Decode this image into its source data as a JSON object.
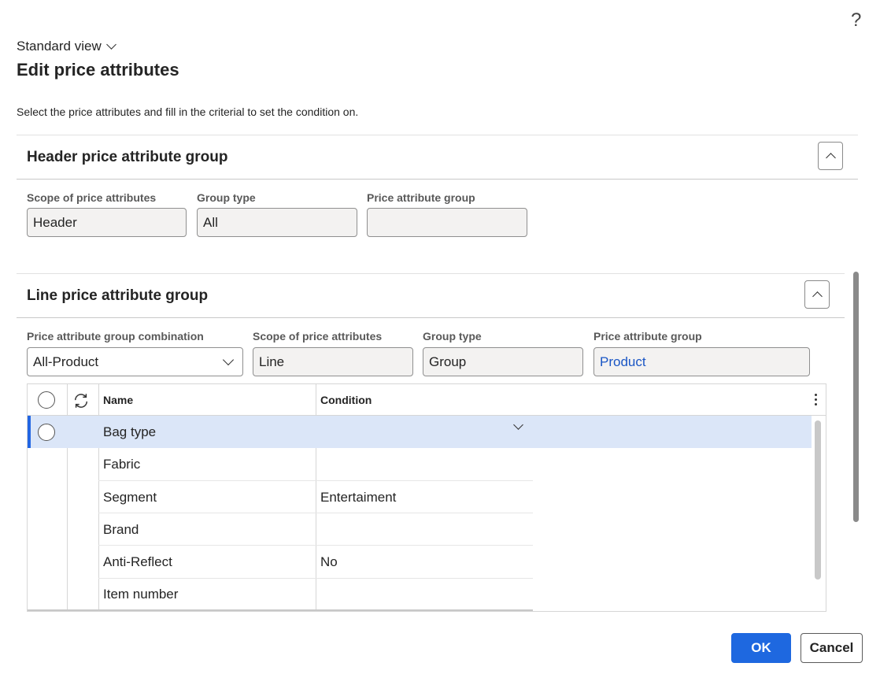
{
  "help_icon_glyph": "?",
  "view": {
    "label": "Standard view"
  },
  "dialog": {
    "title": "Edit price attributes",
    "description": "Select the price attributes and fill in the criterial to set the condition on."
  },
  "header_group": {
    "title": "Header price attribute group",
    "fields": [
      {
        "label": "Scope of price attributes",
        "value": "Header"
      },
      {
        "label": "Group type",
        "value": "All"
      },
      {
        "label": "Price attribute group",
        "value": ""
      }
    ]
  },
  "line_group": {
    "title": "Line price attribute group",
    "combination": {
      "label": "Price attribute group combination",
      "value": "All-Product"
    },
    "fields": [
      {
        "label": "Scope of price attributes",
        "value": "Line"
      },
      {
        "label": "Group type",
        "value": "Group"
      },
      {
        "label": "Price attribute group",
        "value": "Product"
      }
    ]
  },
  "grid": {
    "columns": {
      "name": "Name",
      "condition": "Condition"
    },
    "rows": [
      {
        "name": "Bag type",
        "condition": "",
        "selected": true
      },
      {
        "name": "Fabric",
        "condition": ""
      },
      {
        "name": "Segment",
        "condition": "Entertaiment"
      },
      {
        "name": "Brand",
        "condition": ""
      },
      {
        "name": "Anti-Reflect",
        "condition": "No"
      },
      {
        "name": "Item number",
        "condition": ""
      }
    ]
  },
  "footer": {
    "ok_label": "OK",
    "cancel_label": "Cancel"
  },
  "colors": {
    "accent": "#1e68e0",
    "selected_row": "#dbe6f8",
    "link": "#1a56c5"
  }
}
